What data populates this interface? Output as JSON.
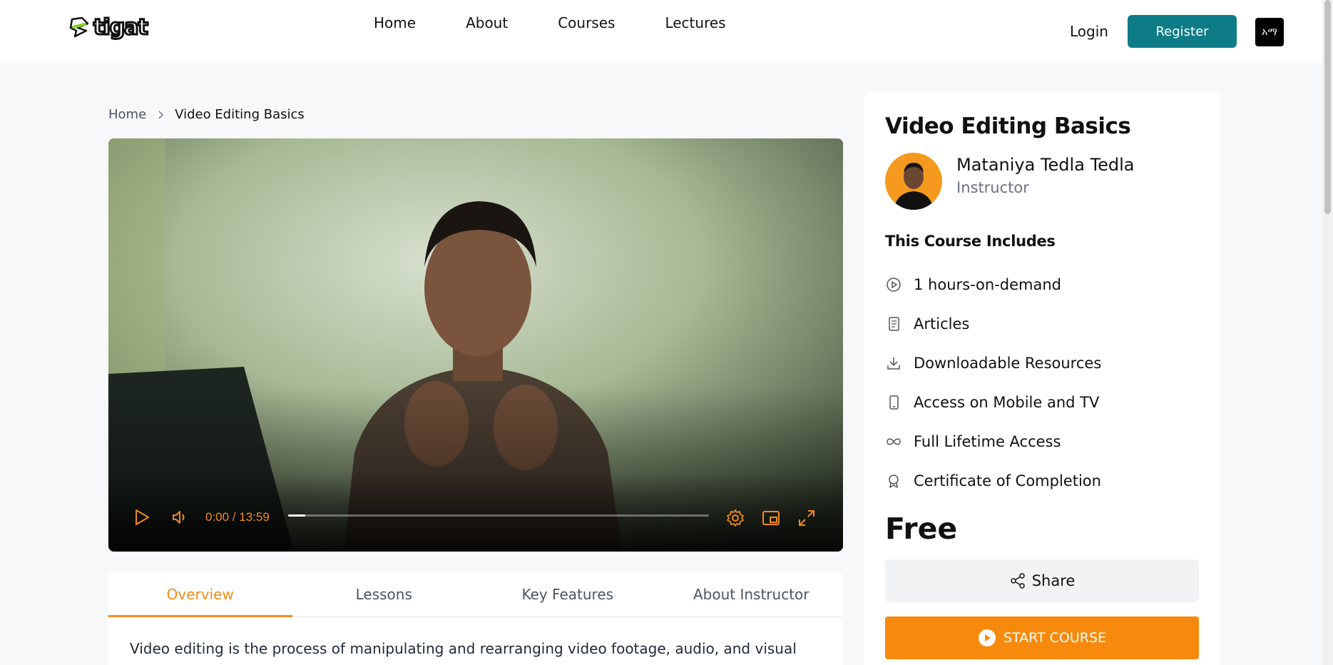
{
  "header": {
    "logo_text": "tigat",
    "nav": [
      "Home",
      "About",
      "Courses",
      "Lectures"
    ],
    "login_label": "Login",
    "register_label": "Register",
    "language_label": "አማ"
  },
  "breadcrumb": {
    "home": "Home",
    "current": "Video Editing Basics"
  },
  "video": {
    "time": "0:00 / 13:59",
    "progress_fraction": 0.04,
    "accent_color": "#f08a1c"
  },
  "tabs": [
    {
      "label": "Overview",
      "active": true
    },
    {
      "label": "Lessons",
      "active": false
    },
    {
      "label": "Key Features",
      "active": false
    },
    {
      "label": "About Instructor",
      "active": false
    }
  ],
  "overview_text": "Video editing is the process of manipulating and rearranging video footage, audio, and visual",
  "course": {
    "title": "Video Editing Basics",
    "instructor_name": "Mataniya Tedla Tedla",
    "instructor_role": "Instructor",
    "includes_title": "This Course Includes",
    "includes": [
      {
        "icon": "play-circle-icon",
        "label": "1 hours-on-demand"
      },
      {
        "icon": "article-icon",
        "label": "Articles"
      },
      {
        "icon": "download-icon",
        "label": "Downloadable Resources"
      },
      {
        "icon": "mobile-icon",
        "label": "Access on Mobile and TV"
      },
      {
        "icon": "infinity-icon",
        "label": "Full Lifetime Access"
      },
      {
        "icon": "certificate-icon",
        "label": "Certificate of Completion"
      }
    ],
    "price": "Free",
    "share_label": "Share",
    "start_label": "START COURSE"
  },
  "colors": {
    "brand_teal": "#0e7c86",
    "accent_orange": "#f78a0d"
  }
}
